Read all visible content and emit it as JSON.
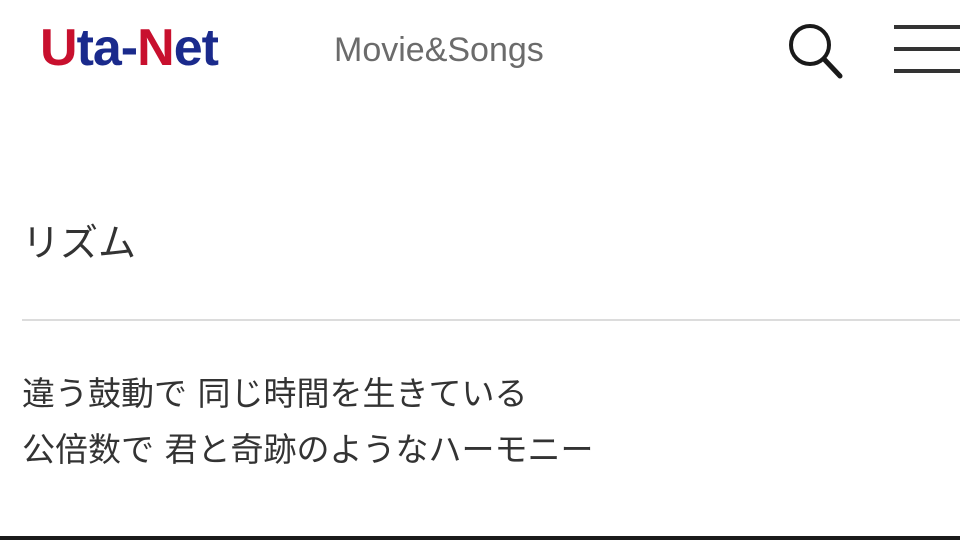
{
  "header": {
    "logo": {
      "part1": "U",
      "part2": "ta-",
      "part3": "N",
      "part4": "et"
    },
    "subtitle": "Movie&Songs",
    "search_icon": "search-icon",
    "menu_icon": "hamburger-menu-icon"
  },
  "song": {
    "title": "リズム"
  },
  "lyrics": [
    "違う鼓動で 同じ時間を生きている",
    "公倍数で 君と奇跡のようなハーモニー"
  ],
  "colors": {
    "logo_red": "#c8102e",
    "logo_blue": "#1a2a8c",
    "subtitle_gray": "#6b6b6b",
    "text": "#333333",
    "divider": "#dcdcdc"
  }
}
